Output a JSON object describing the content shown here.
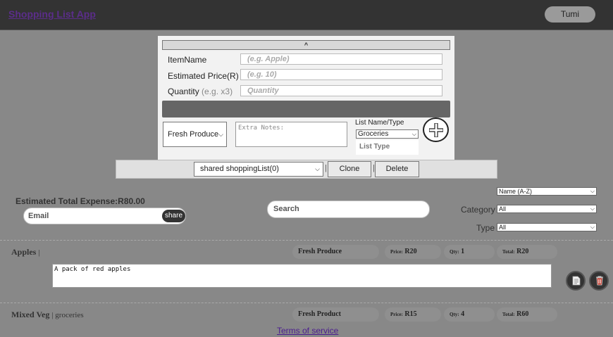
{
  "header": {
    "app_title": "Shopping List App",
    "user_button": "Tumi"
  },
  "add_panel": {
    "collapse_label": "^",
    "item_name_label": "ItemName",
    "item_name_placeholder": "(e.g. Apple)",
    "price_label": "Estimated Price(R)",
    "price_placeholder": "(e.g. 10)",
    "quantity_label": "Quantity",
    "quantity_hint": "(e.g. x3)",
    "quantity_placeholder": "Quantity",
    "category_value": "Fresh Produce",
    "notes_placeholder": "Extra Notes:",
    "list_name_label": "List Name/Type",
    "list_type_select_value": "Groceries",
    "list_type_placeholder": "List Type",
    "add_icon": "plus-circle-icon"
  },
  "list_toolbar": {
    "shared_list_value": "shared shoppingList(0)",
    "separator": "|",
    "clone_label": "Clone",
    "delete_label": "Delete"
  },
  "filters": {
    "total_label": "Estimated Total Expense:",
    "total_value": "R80.00",
    "email_placeholder": "Email",
    "share_label": "share",
    "search_placeholder": "Search",
    "sort_value": "Name (A-Z)",
    "category_label": "Category",
    "category_value": "All",
    "type_label": "Type",
    "type_value": "All"
  },
  "items": [
    {
      "name": "Apples",
      "sub": "|",
      "category": "Fresh Produce",
      "price_label": "Price:",
      "price": "R20",
      "qty_label": "Qty:",
      "qty": "1",
      "total_label": "Total:",
      "total": "R20",
      "notes": "A pack of red apples"
    },
    {
      "name": "Mixed Veg",
      "sub": "| groceries",
      "category": "Fresh Product",
      "price_label": "Price:",
      "price": "R15",
      "qty_label": "Qty:",
      "qty": "4",
      "total_label": "Total:",
      "total": "R60"
    }
  ],
  "footer": {
    "terms": "Terms of service"
  },
  "colors": {
    "header_bg": "#333333",
    "page_bg": "#888888",
    "link": "#5b2d8a"
  }
}
